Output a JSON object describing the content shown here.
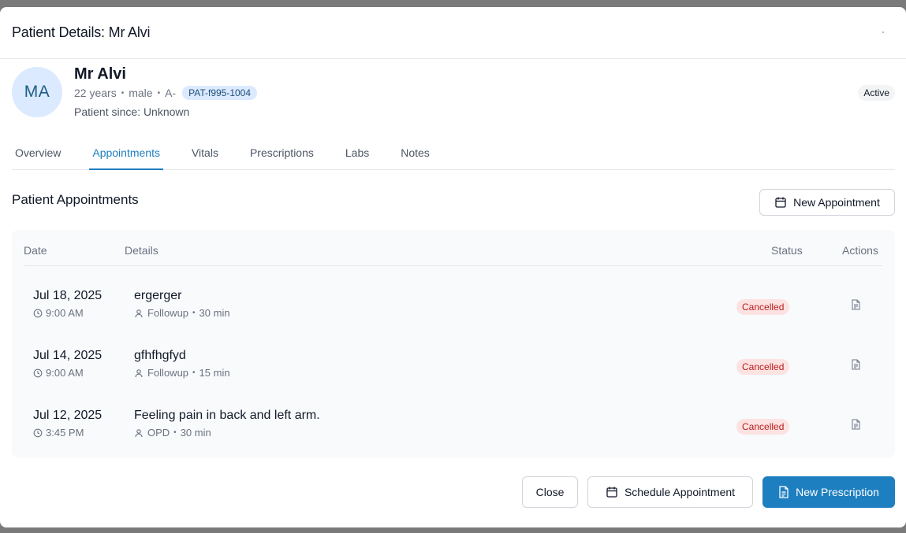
{
  "modal": {
    "title": "Patient Details: Mr Alvi"
  },
  "patient": {
    "initials": "MA",
    "name": "Mr Alvi",
    "age": "22 years",
    "gender": "male",
    "blood_group": "A-",
    "id": "PAT-f995-1004",
    "since": "Patient since: Unknown",
    "status": "Active"
  },
  "tabs": [
    {
      "label": "Overview"
    },
    {
      "label": "Appointments"
    },
    {
      "label": "Vitals"
    },
    {
      "label": "Prescriptions"
    },
    {
      "label": "Labs"
    },
    {
      "label": "Notes"
    }
  ],
  "active_tab": "Appointments",
  "appointments": {
    "title": "Patient Appointments",
    "new_button": "New Appointment",
    "columns": {
      "date": "Date",
      "details": "Details",
      "status": "Status",
      "actions": "Actions"
    },
    "rows": [
      {
        "date": "Jul 18, 2025",
        "time": "9:00 AM",
        "reason": "ergerger",
        "type": "Followup",
        "duration": "30 min",
        "status": "Cancelled"
      },
      {
        "date": "Jul 14, 2025",
        "time": "9:00 AM",
        "reason": "gfhfhgfyd",
        "type": "Followup",
        "duration": "15 min",
        "status": "Cancelled"
      },
      {
        "date": "Jul 12, 2025",
        "time": "3:45 PM",
        "reason": "Feeling pain in back and left arm.",
        "type": "OPD",
        "duration": "30 min",
        "status": "Cancelled"
      }
    ]
  },
  "footer": {
    "close": "Close",
    "schedule": "Schedule Appointment",
    "new_prescription": "New Prescription"
  },
  "colors": {
    "accent": "#1e7fc0",
    "cancelled_bg": "#fde2e2",
    "cancelled_text": "#b91c1c"
  },
  "icons": {
    "calendar": "calendar-icon",
    "clock": "clock-icon",
    "user": "user-icon",
    "document": "document-icon"
  }
}
